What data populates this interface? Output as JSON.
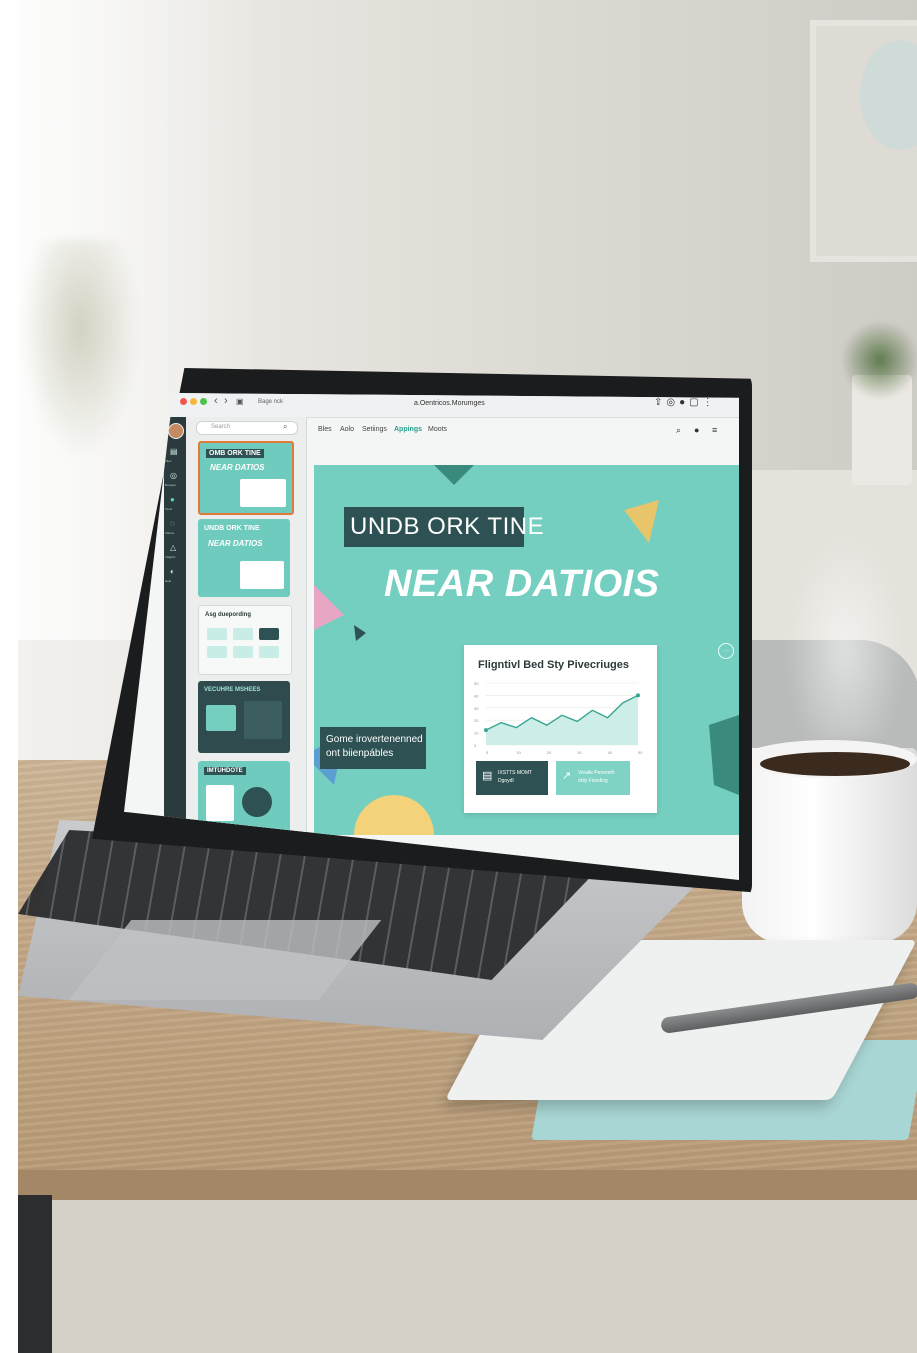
{
  "browser": {
    "tab_title": "Bage nck",
    "url": "a.Oentricos.Morumges"
  },
  "search": {
    "placeholder": "Search"
  },
  "rail": {
    "items": [
      "Files",
      "Designs",
      "Tools",
      "Videos",
      "Insights",
      "Help"
    ]
  },
  "toolbar": {
    "tabs": [
      "Bles",
      "Aolo",
      "Setiings",
      "Appings",
      "Moots"
    ],
    "active_tab": "Appings"
  },
  "thumbnails": [
    {
      "title": "OMB ORK TINE",
      "subtitle": "NEAR DATIOS"
    },
    {
      "title": "UNDB ORK TINE",
      "subtitle": "NEAR DATIOS"
    },
    {
      "title": "Asg duepording"
    },
    {
      "title": "VECUHRE MSHEES"
    },
    {
      "title": "IMTUHDOTE"
    }
  ],
  "slide": {
    "banner": "UNDB ORK TINE",
    "headline": "NEAR DATIOIS",
    "caption_line1": "Gome irovertenenned",
    "caption_line2": "ont biienpábles",
    "chart_title": "Fligntivl Bed Sty Pivecriuges",
    "chart_x_ticks": [
      "0",
      "10",
      "20",
      "30",
      "40",
      "50"
    ],
    "chart_y_ticks": [
      "50",
      "40",
      "30",
      "20",
      "10",
      "0"
    ],
    "chart_points": [
      12,
      18,
      14,
      22,
      16,
      24,
      19,
      28,
      22,
      34,
      40
    ],
    "button1_line1": "IXSTTS MOMT",
    "button1_line2": "Dgoydl",
    "button2_line1": "Viealle Peoereth",
    "button2_line2": "drily Flunding"
  },
  "colors": {
    "accent": "#74cfc1",
    "dark_teal": "#2e5153"
  }
}
